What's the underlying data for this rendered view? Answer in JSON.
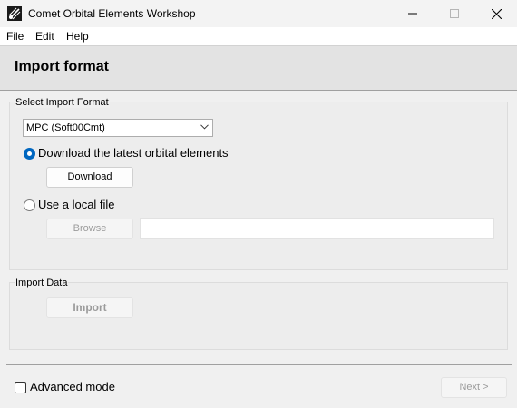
{
  "window": {
    "title": "Comet Orbital Elements Workshop",
    "app_icon": "comet-app-icon",
    "minimize_icon": "minimize-icon",
    "maximize_icon": "maximize-icon",
    "close_icon": "close-icon"
  },
  "menu": {
    "items": [
      "File",
      "Edit",
      "Help"
    ]
  },
  "header": {
    "title": "Import format"
  },
  "import_format": {
    "group_label": "Select Import Format",
    "format_selected": "MPC (Soft00Cmt)",
    "option_download_label": "Download the latest orbital elements",
    "option_download_selected": true,
    "download_button": "Download",
    "option_local_label": "Use a local file",
    "option_local_selected": false,
    "browse_button": "Browse",
    "file_path_value": ""
  },
  "import_data": {
    "group_label": "Import Data",
    "import_button": "Import"
  },
  "footer": {
    "advanced_mode_label": "Advanced mode",
    "advanced_mode_checked": false,
    "next_button": "Next >"
  },
  "colors": {
    "accent": "#0067c0",
    "header_bg": "#e3e3e3",
    "disabled_text": "#9b9b9b"
  }
}
